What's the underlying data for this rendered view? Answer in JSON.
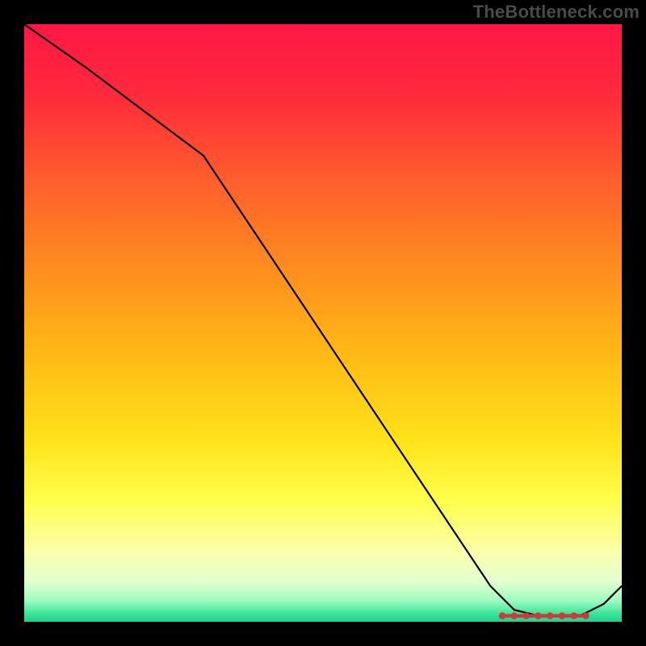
{
  "watermark": "TheBottleneck.com",
  "chart_data": {
    "type": "line",
    "title": "",
    "xlabel": "",
    "ylabel": "",
    "xlim": [
      0,
      100
    ],
    "ylim": [
      0,
      100
    ],
    "grid": false,
    "legend": false,
    "background_gradient": {
      "stops": [
        {
          "offset": 0.0,
          "color": "#ff1744"
        },
        {
          "offset": 0.12,
          "color": "#ff2a3c"
        },
        {
          "offset": 0.25,
          "color": "#ff5a2e"
        },
        {
          "offset": 0.4,
          "color": "#ff8a1f"
        },
        {
          "offset": 0.55,
          "color": "#ffb915"
        },
        {
          "offset": 0.7,
          "color": "#ffe31a"
        },
        {
          "offset": 0.8,
          "color": "#ffff4d"
        },
        {
          "offset": 0.88,
          "color": "#faffa8"
        },
        {
          "offset": 0.93,
          "color": "#e6ffcf"
        },
        {
          "offset": 0.965,
          "color": "#9dfbc0"
        },
        {
          "offset": 0.985,
          "color": "#40e69b"
        },
        {
          "offset": 1.0,
          "color": "#18d28a"
        }
      ]
    },
    "series": [
      {
        "name": "curve",
        "color": "#000000",
        "x": [
          0,
          10,
          22,
          30,
          40,
          50,
          60,
          70,
          78,
          82,
          86,
          90,
          93,
          97,
          100
        ],
        "y": [
          100,
          93,
          84,
          78,
          63,
          48,
          33,
          18,
          6,
          2,
          1,
          1,
          1,
          3,
          6
        ]
      }
    ],
    "optimal_band": {
      "x_range": [
        80,
        94
      ],
      "y": 1,
      "color": "#cc3b3b",
      "marker_count": 8
    }
  }
}
